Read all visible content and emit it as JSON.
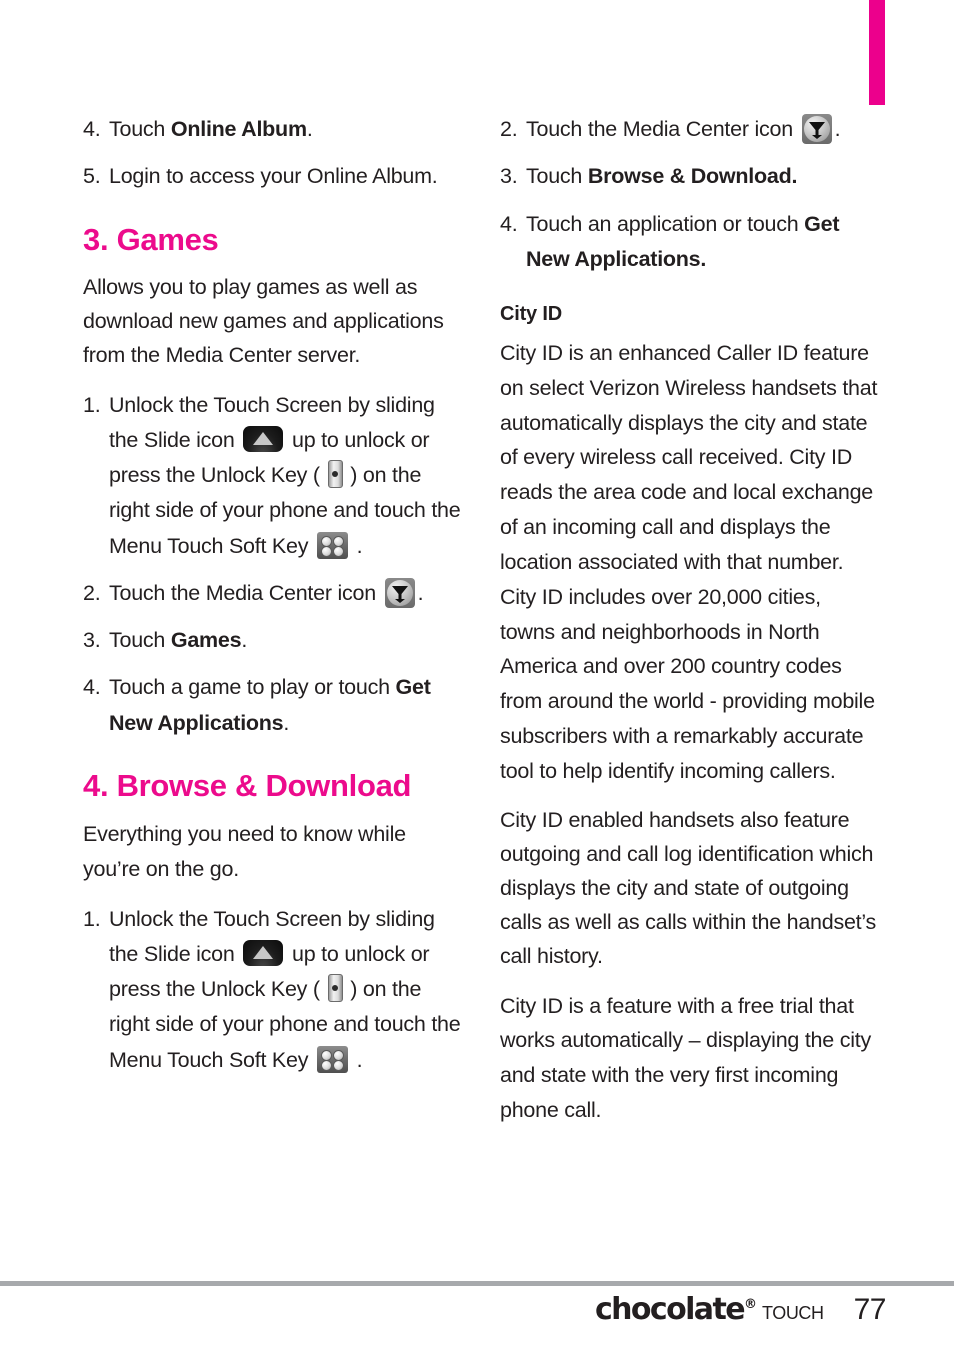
{
  "page": {
    "number": "77",
    "tab_marker_color": "#ec008c",
    "heading_color": "#ec0b8c"
  },
  "footer": {
    "brand": "chocolate",
    "registered_mark": "®",
    "product": "TOUCH"
  },
  "left_column": {
    "online_album_steps": [
      {
        "num": "4.",
        "pre": "Touch ",
        "bold": "Online Album",
        "post": "."
      },
      {
        "num": "5.",
        "pre": " Login to access your Online Album.",
        "bold": "",
        "post": ""
      }
    ],
    "games": {
      "heading": "3. Games",
      "intro": "Allows you to play games as well as download new games and applications from the Media Center server.",
      "steps": {
        "unlock_num": "1.",
        "unlock_a": "Unlock the Touch Screen by sliding the Slide icon ",
        "unlock_b": " up to unlock or press the Unlock Key ( ",
        "unlock_c": " ) on the right side of your phone and touch the Menu Touch Soft Key ",
        "unlock_d": " .",
        "media_num": "2.",
        "media_a": "Touch the Media Center icon ",
        "media_b": ".",
        "step3_num": "3.",
        "step3_pre": "Touch ",
        "step3_bold": "Games",
        "step3_post": ".",
        "step4_num": "4.",
        "step4_pre": "Touch a game to play or touch ",
        "step4_bold": "Get New Applications",
        "step4_post": "."
      }
    },
    "browse": {
      "heading": "4. Browse & Download",
      "intro": "Everything you need to know while you’re on the go.",
      "steps": {
        "unlock_num": "1.",
        "unlock_a": "Unlock the Touch Screen by sliding the Slide icon ",
        "unlock_b": " up to unlock or press the Unlock Key ( ",
        "unlock_c": " ) on the right side of your phone and touch the Menu Touch Soft Key ",
        "unlock_d": " ."
      }
    }
  },
  "right_column": {
    "browse_steps": {
      "media_num": "2.",
      "media_a": "Touch the Media Center icon ",
      "media_b": ".",
      "step3_num": "3.",
      "step3_pre": "Touch ",
      "step3_bold": "Browse & Download.",
      "step4_num": "4.",
      "step4_pre": "Touch an application or touch ",
      "step4_bold": "Get New Applications."
    },
    "city_id": {
      "heading": "City ID",
      "paragraph_1": "City ID is an enhanced Caller ID feature on select Verizon Wireless handsets that automatically displays the city and state of every wireless call received. City ID reads the area code and local exchange of an incoming call and displays the location associated with that number.  City ID includes over 20,000 cities, towns and neighborhoods in North America and over 200 country codes from around the world - providing mobile subscribers with a remarkably accurate tool to help identify incoming callers.",
      "paragraph_2": "City ID enabled handsets also feature outgoing and call log identification which displays the city and state of outgoing calls as well as calls within the handset’s call history.",
      "paragraph_3": "City ID is a feature with a free trial that works automatically – displaying the city and state with the very first incoming phone call."
    }
  },
  "icons": {
    "slide": "slide-up-icon",
    "unlock_key": "unlock-key-icon",
    "menu_soft_key": "menu-soft-key-icon",
    "media_center": "media-center-icon"
  }
}
